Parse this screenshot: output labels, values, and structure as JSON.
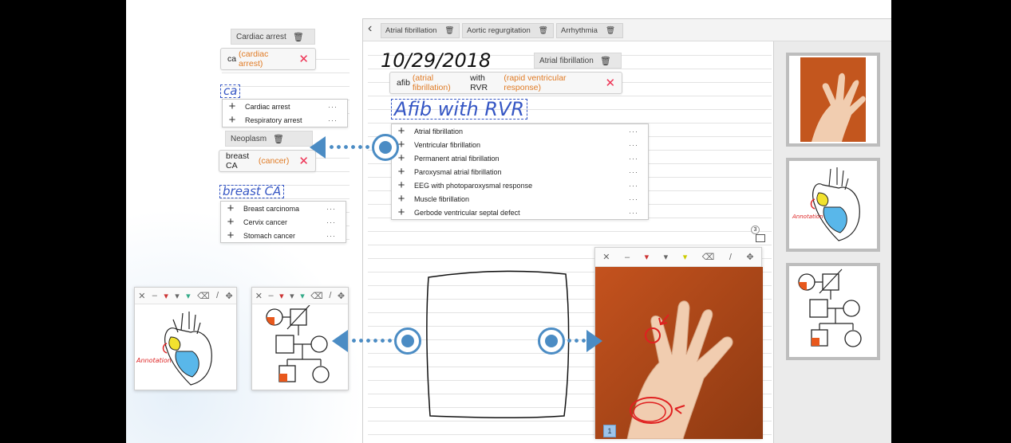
{
  "left_snippets": {
    "cardiac": {
      "tag": "Cardiac arrest",
      "abbr": "ca",
      "expansion": "(cardiac arrest)",
      "ink": "ca",
      "suggestions": [
        "Cardiac arrest",
        "Respiratory arrest"
      ]
    },
    "breast": {
      "tag": "Neoplasm",
      "abbr": "breast CA",
      "expansion": "(cancer)",
      "ink": "breast  CA",
      "suggestions": [
        "Breast carcinoma",
        "Cervix cancer",
        "Stomach cancer"
      ]
    }
  },
  "app": {
    "tabs": [
      "Atrial fibrillation",
      "Aortic regurgitation",
      "Arrhythmia"
    ],
    "date": "10/29/2018",
    "tag": "Atrial fibrillation",
    "expand": {
      "abbr": "afib",
      "abbr_exp": "(atrial fibrillation)",
      "mid": "with RVR",
      "mid_exp": "(rapid ventricular response)"
    },
    "ink": "Afib  with  RVR",
    "suggestions": [
      "Atrial fibrillation",
      "Ventricular fibrillation",
      "Permanent atrial fibrillation",
      "Paroxysmal atrial fibrillation",
      "EEG with photoparoxysmal response",
      "Muscle fibrillation",
      "Gerbode ventricular septal defect"
    ],
    "badge_count": "3",
    "annotation_index": "1"
  },
  "more_glyph": "···",
  "plus_glyph": "+",
  "trash_glyph": "🗑",
  "close_glyph": "✕",
  "heart_annotation": "Annotation",
  "colors": {
    "accent_blue": "#4b8cc4",
    "ink_blue": "#3556c4",
    "orange": "#e07b25",
    "red_x": "#e33355"
  }
}
